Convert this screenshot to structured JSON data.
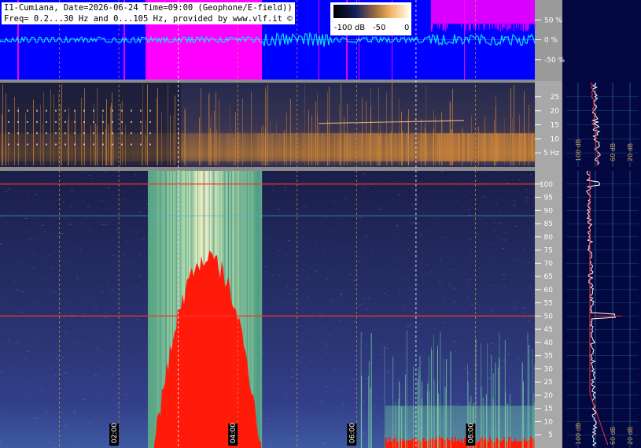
{
  "header": {
    "line1": "I1-Cumiana, Date=2026-06-24 Time=09:00 (Geophone/E-field))",
    "line2": "Freq= 0.2...30 Hz and 0...105 Hz, provided by www.vlf.it ©"
  },
  "colorbar": {
    "labels": [
      "-100 dB",
      "-50",
      "0"
    ]
  },
  "chart_data": [
    {
      "type": "line",
      "panel": "amplitude",
      "ylabel_ticks": [
        "50 %",
        "0 %",
        "-50 %"
      ],
      "y_values": [
        50,
        0,
        -50
      ],
      "ylim": [
        -100,
        100
      ]
    },
    {
      "type": "heatmap",
      "panel": "spectrogram-low",
      "yticks": [
        25,
        20,
        15,
        10,
        5
      ],
      "ytick_labels": [
        "25",
        "20",
        "15",
        "10",
        "5 Hz"
      ],
      "ylim": [
        0,
        30
      ]
    },
    {
      "type": "heatmap",
      "panel": "spectrogram-high",
      "yticks": [
        100,
        95,
        90,
        85,
        80,
        75,
        70,
        65,
        60,
        55,
        50,
        45,
        40,
        35,
        30,
        25,
        20,
        15,
        10,
        5
      ],
      "ylim": [
        0,
        105
      ],
      "lines_hz": [
        50,
        100
      ]
    },
    {
      "type": "line",
      "panel": "spectrum-low",
      "xtick_labels": [
        "100 dB",
        "60 dB",
        "20 dB"
      ]
    },
    {
      "type": "line",
      "panel": "spectrum-high",
      "xtick_labels": [
        "100 dB",
        "60 dB",
        "20 dB"
      ]
    }
  ],
  "time_axis": {
    "labels": [
      "02:00",
      "04:00",
      "06:00",
      "08:00"
    ]
  },
  "colors": {
    "amp_blue": "#0000ff",
    "amp_magenta": "#ff00ff",
    "amp_cyan": "#00e5ff",
    "spec_dark": "#1e2454",
    "spec_orange": "#d2873a",
    "spec_green": "#7fe0a6",
    "spec_yellow": "#fff6c0",
    "spec_red": "#ff1a0a",
    "grid_orange": "#d99a40",
    "grid_red": "#ff3030",
    "grid_cyan": "#3fb6d6",
    "side_bg": "#040840"
  }
}
